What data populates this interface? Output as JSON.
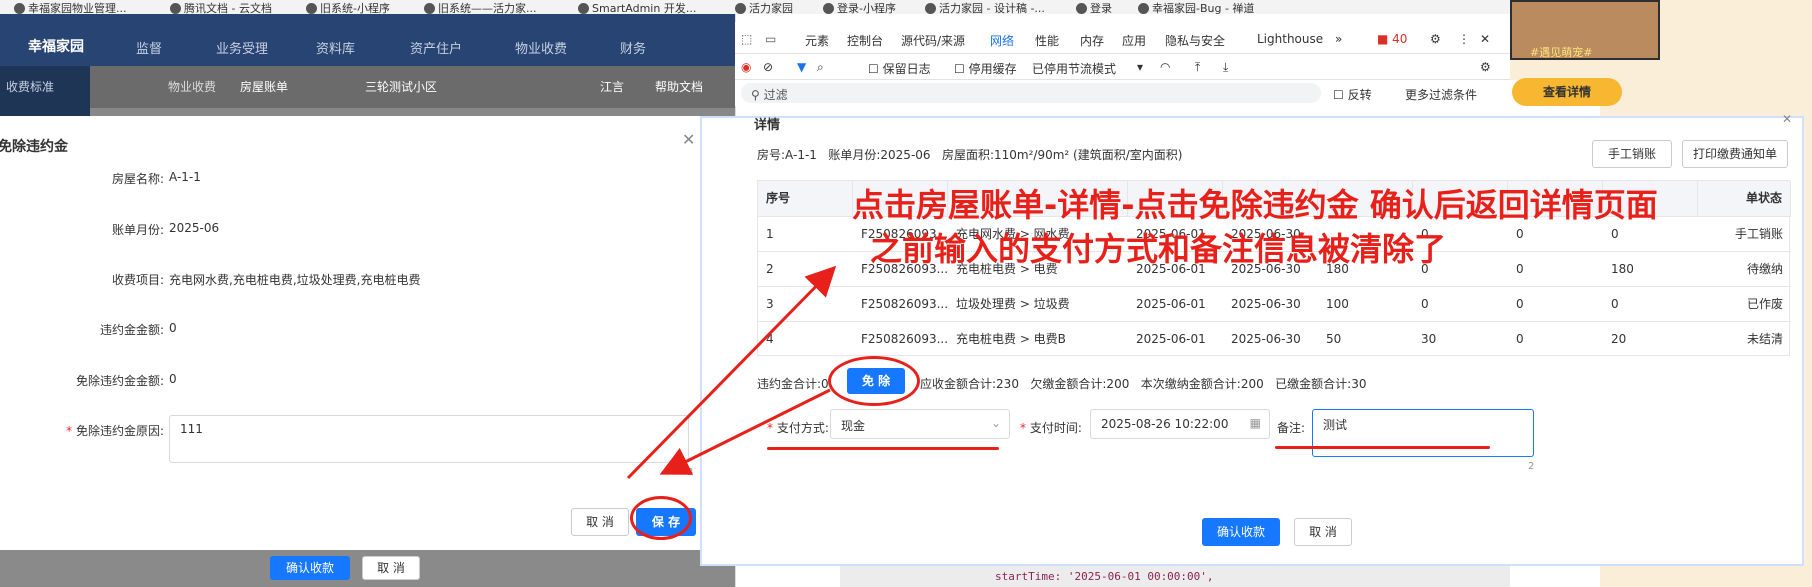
{
  "bookmarks": [
    "幸福家园物业管理...",
    "腾讯文档 - 云文档",
    "旧系统-小程序",
    "旧系统——活力家...",
    "SmartAdmin 开发...",
    "活力家园",
    "登录-小程序",
    "活力家园 - 设计稿 -...",
    "登录",
    "幸福家园-Bug - 禅道"
  ],
  "app": {
    "brand": "幸福家园",
    "nav": [
      "监督",
      "业务受理",
      "资料库",
      "资产住户",
      "物业收费",
      "财务"
    ],
    "side_label": "收费标准",
    "breadcrumb": [
      "物业收费",
      "房屋账单"
    ],
    "community": "三轮测试小区",
    "user": "江言",
    "help": "帮助文档",
    "bottom_confirm": "确认收款",
    "bottom_cancel": "取 消"
  },
  "waiver_dialog": {
    "title": "免除违约金",
    "fields": [
      {
        "label": "房屋名称:",
        "value": "A-1-1"
      },
      {
        "label": "账单月份:",
        "value": "2025-06"
      },
      {
        "label": "收费项目:",
        "value": "充电网水费,充电桩电费,垃圾处理费,充电桩电费"
      },
      {
        "label": "违约金金额:",
        "value": "0"
      },
      {
        "label": "免除违约金金额:",
        "value": "0"
      }
    ],
    "reason_label": "免除违约金原因:",
    "reason_value": "111",
    "char_count": "3",
    "cancel": "取 消",
    "save": "保 存"
  },
  "devtools": {
    "tabs": [
      "元素",
      "控制台",
      "源代码/来源",
      "网络",
      "性能",
      "内存",
      "应用",
      "隐私与安全",
      "Lighthouse"
    ],
    "active_tab": "网络",
    "issues_count": "40",
    "toolbar": [
      "保留日志",
      "停用缓存",
      "已停用节流模式"
    ],
    "filter_placeholder": "过滤",
    "invert": "反转",
    "more_filters": "更多过滤条件",
    "code_line": "startTime: '2025-06-01 00:00:00',"
  },
  "detail_dialog": {
    "title": "详情",
    "info": "房号:A-1-1   账单月份:2025-06   房屋面积:110m²/90m² (建筑面积/室内面积)",
    "btn_manual": "手工销账",
    "btn_print": "打印缴费通知单",
    "columns": [
      "序号",
      "",
      "",
      "",
      "",
      "",
      "",
      "",
      "",
      "单状态"
    ],
    "rows": [
      [
        "1",
        "F250826093...",
        "充电网水费 > 网水费",
        "2025-06-01",
        "2025-06-30",
        "",
        "0",
        "0",
        "0",
        "手工销账"
      ],
      [
        "2",
        "F250826093...",
        "充电桩电费 > 电费",
        "2025-06-01",
        "2025-06-30",
        "180",
        "0",
        "0",
        "180",
        "待缴纳"
      ],
      [
        "3",
        "F250826093...",
        "垃圾处理费 > 垃圾费",
        "2025-06-01",
        "2025-06-30",
        "100",
        "0",
        "0",
        "0",
        "已作废"
      ],
      [
        "4",
        "F250826093...",
        "充电桩电费 > 电费B",
        "2025-06-01",
        "2025-06-30",
        "50",
        "30",
        "0",
        "20",
        "未结清"
      ]
    ],
    "summary_penalty": "违约金合计:0",
    "waive_btn": "免 除",
    "summary_rest": "应收金额合计:230   欠缴金额合计:200   本次缴纳金额合计:200   已缴金额合计:30",
    "pay_method_label": "支付方式:",
    "pay_method_value": "现金",
    "pay_time_label": "支付时间:",
    "pay_time_value": "2025-08-26 10:22:00",
    "remark_label": "备注:",
    "remark_value": "测试",
    "remark_count": "2",
    "confirm": "确认收款",
    "cancel": "取 消"
  },
  "ad": {
    "tag": "#遇见萌宠#",
    "button": "查看详情"
  },
  "annotation": {
    "line1": "点击房屋账单-详情-点击免除违约金 确认后返回详情页面",
    "line2": "之前输入的支付方式和备注信息被清除了",
    "color": "#e8201a"
  }
}
